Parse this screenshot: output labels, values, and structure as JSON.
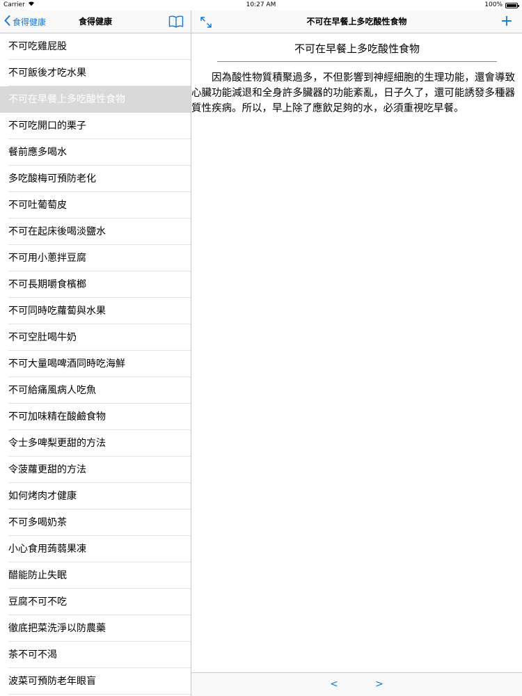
{
  "status_bar": {
    "carrier": "Carrier",
    "time": "10:27 AM",
    "battery": "100%",
    "battery_level": 1.0
  },
  "master": {
    "back_label": "食得健康",
    "title": "食得健康",
    "items": [
      {
        "label": "不可吃雞屁股"
      },
      {
        "label": "不可飯後才吃水果"
      },
      {
        "label": "不可在早餐上多吃酸性食物",
        "selected": true
      },
      {
        "label": "不可吃開口的栗子"
      },
      {
        "label": "餐前應多喝水"
      },
      {
        "label": "多吃酸梅可預防老化"
      },
      {
        "label": "不可吐葡萄皮"
      },
      {
        "label": "不可在起床後喝淡鹽水"
      },
      {
        "label": "不可用小蔥拌豆腐"
      },
      {
        "label": "不可長期嚼食檳榔"
      },
      {
        "label": "不可同時吃蘿蔔與水果"
      },
      {
        "label": "不可空肚喝牛奶"
      },
      {
        "label": "不可大量喝啤酒同時吃海鮮"
      },
      {
        "label": "不可給痛風病人吃魚"
      },
      {
        "label": "不可加味精在酸鹼食物"
      },
      {
        "label": "令士多啤梨更甜的方法"
      },
      {
        "label": "令菠蘿更甜的方法"
      },
      {
        "label": "如何烤肉才健康"
      },
      {
        "label": "不可多喝奶茶"
      },
      {
        "label": "小心食用蒟蒻果凍"
      },
      {
        "label": "醋能防止失眠"
      },
      {
        "label": "豆腐不可不吃"
      },
      {
        "label": "徹底把菜洗淨以防農藥"
      },
      {
        "label": "茶不可不渴"
      },
      {
        "label": "波菜可預防老年眼盲"
      }
    ]
  },
  "detail": {
    "title": "不可在早餐上多吃酸性食物",
    "heading": "不可在早餐上多吃酸性食物",
    "body": "因為酸性物質積聚過多，不但影響到神經細胞的生理功能，還會導致心臟功能減退和全身許多臟器的功能紊亂，日子久了，還可能誘發多種器質性疾病。所以，早上除了應飲足夠的水，必須重視吃早餐。",
    "prev_label": "<",
    "next_label": ">",
    "add_label": "+"
  },
  "colors": {
    "accent": "#1479d6",
    "selected_row": "#d9d9d9"
  }
}
